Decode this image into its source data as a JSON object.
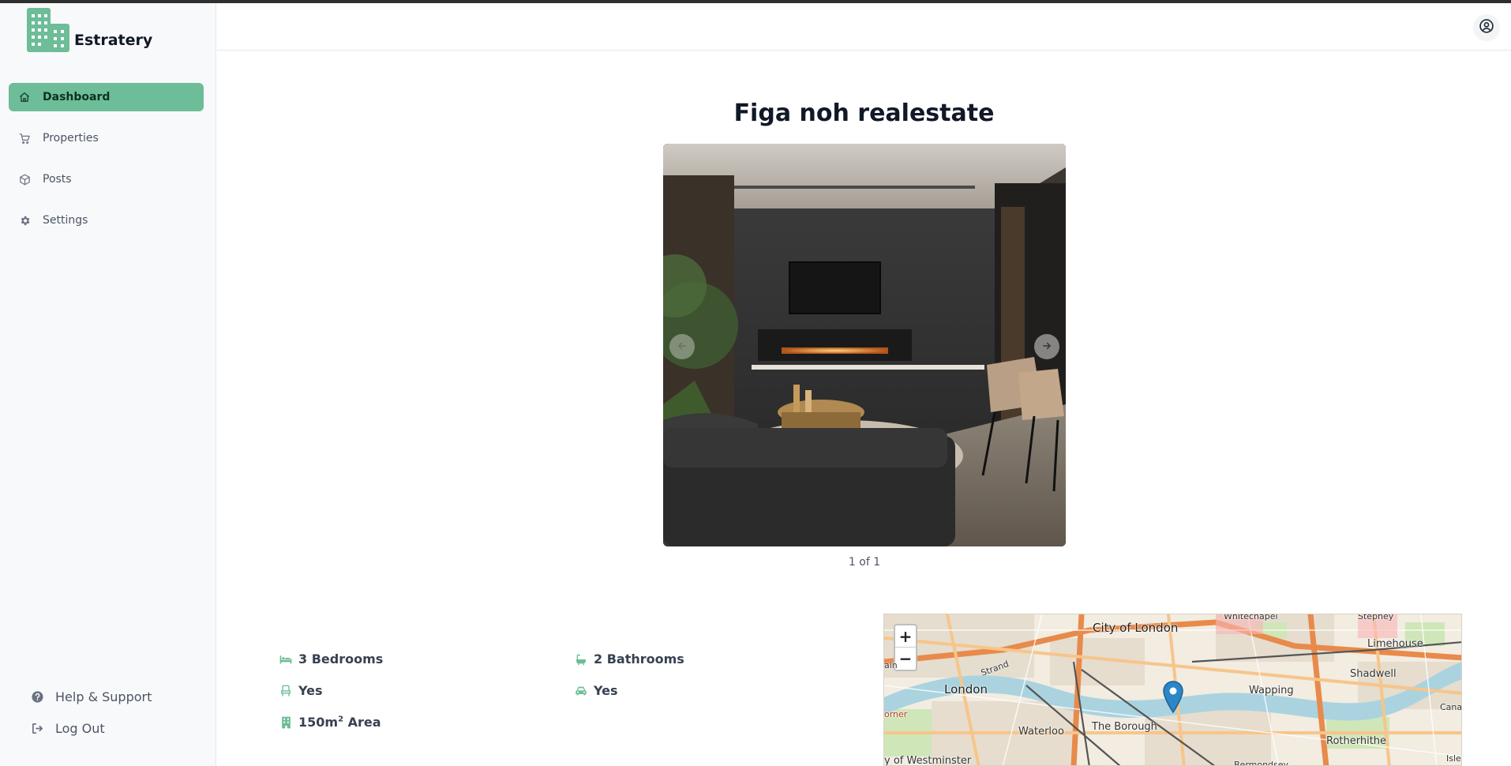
{
  "brand": {
    "name": "Estratery",
    "color": "#6dbd98"
  },
  "sidebar": {
    "items": [
      {
        "label": "Dashboard",
        "icon": "home-icon",
        "active": true
      },
      {
        "label": "Properties",
        "icon": "cart-icon",
        "active": false
      },
      {
        "label": "Posts",
        "icon": "package-icon",
        "active": false
      },
      {
        "label": "Settings",
        "icon": "gear-icon",
        "active": false
      }
    ],
    "bottom": [
      {
        "label": "Help & Support",
        "icon": "help-icon"
      },
      {
        "label": "Log Out",
        "icon": "logout-icon"
      }
    ]
  },
  "header": {
    "user_icon": "user-circle-icon"
  },
  "property": {
    "title": "Figa noh realestate",
    "gallery": {
      "counter": "1 of 1"
    },
    "features": {
      "bedrooms": "3 Bedrooms",
      "bathrooms": "2 Bathrooms",
      "furnished": "Yes",
      "parking": "Yes",
      "area_prefix": "150m",
      "area_sup": "2",
      "area_suffix": " Area"
    }
  },
  "map": {
    "zoom_in": "+",
    "zoom_out": "−",
    "labels": {
      "city_of_london": "City of London",
      "london": "London",
      "waterloo": "Waterloo",
      "the_borough": "The Borough",
      "wapping": "Wapping",
      "shadwell": "Shadwell",
      "limehouse": "Limehouse",
      "rotherhithe": "Rotherhithe",
      "westminster": "y of Westminster",
      "whitechapel": "Whitechapel",
      "stepney": "Stepney",
      "strand": "Strand",
      "bermondsey": "Bermondsey",
      "canary": "Canar",
      "isle": "Isle",
      "borner": "orner",
      "wolst": "ain"
    }
  },
  "colors": {
    "accent": "#6dbd98",
    "river": "#aad3df",
    "road": "#f7c58b",
    "main_road": "#e88a4b"
  }
}
